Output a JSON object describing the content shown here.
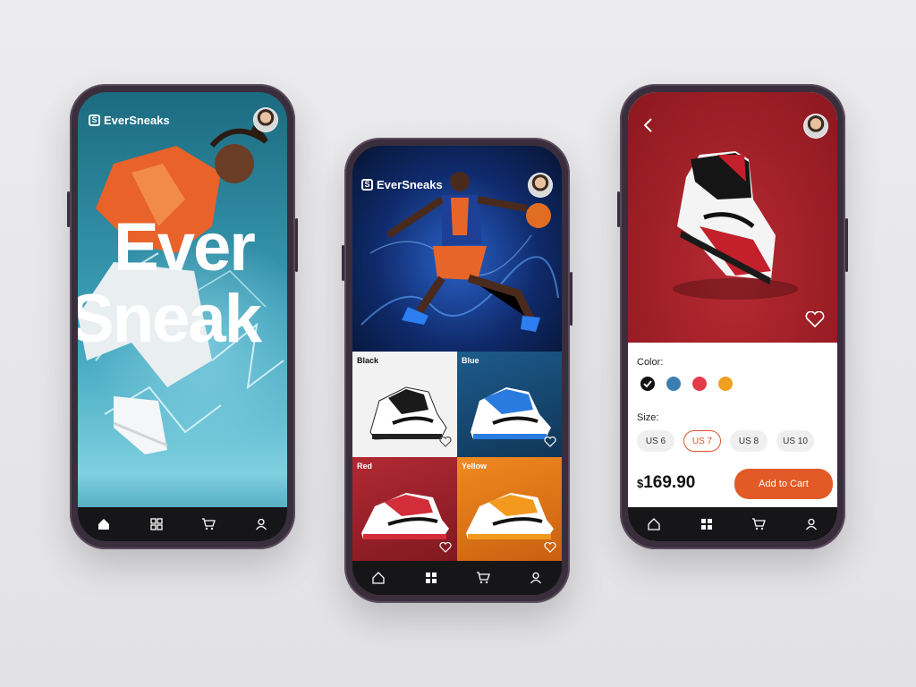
{
  "brand": {
    "name": "EverSneaks"
  },
  "phone1": {
    "hero_line1": "Ever",
    "hero_line2": "Sneak"
  },
  "phone2": {
    "tiles": [
      {
        "label": "Black"
      },
      {
        "label": "Blue"
      },
      {
        "label": "Red"
      },
      {
        "label": "Yellow"
      }
    ]
  },
  "phone3": {
    "color_label": "Color:",
    "colors": [
      "#111111",
      "#3b7fb0",
      "#e23c4a",
      "#f0a020"
    ],
    "selected_color": "#111111",
    "size_label": "Size:",
    "sizes": [
      "US 6",
      "US 7",
      "US 8",
      "US 10"
    ],
    "selected_size": "US 7",
    "price_currency": "$",
    "price_value": "169.90",
    "add_to_cart": "Add to Cart"
  },
  "nav_icons": [
    "home-icon",
    "grid-icon",
    "cart-icon",
    "profile-icon"
  ]
}
